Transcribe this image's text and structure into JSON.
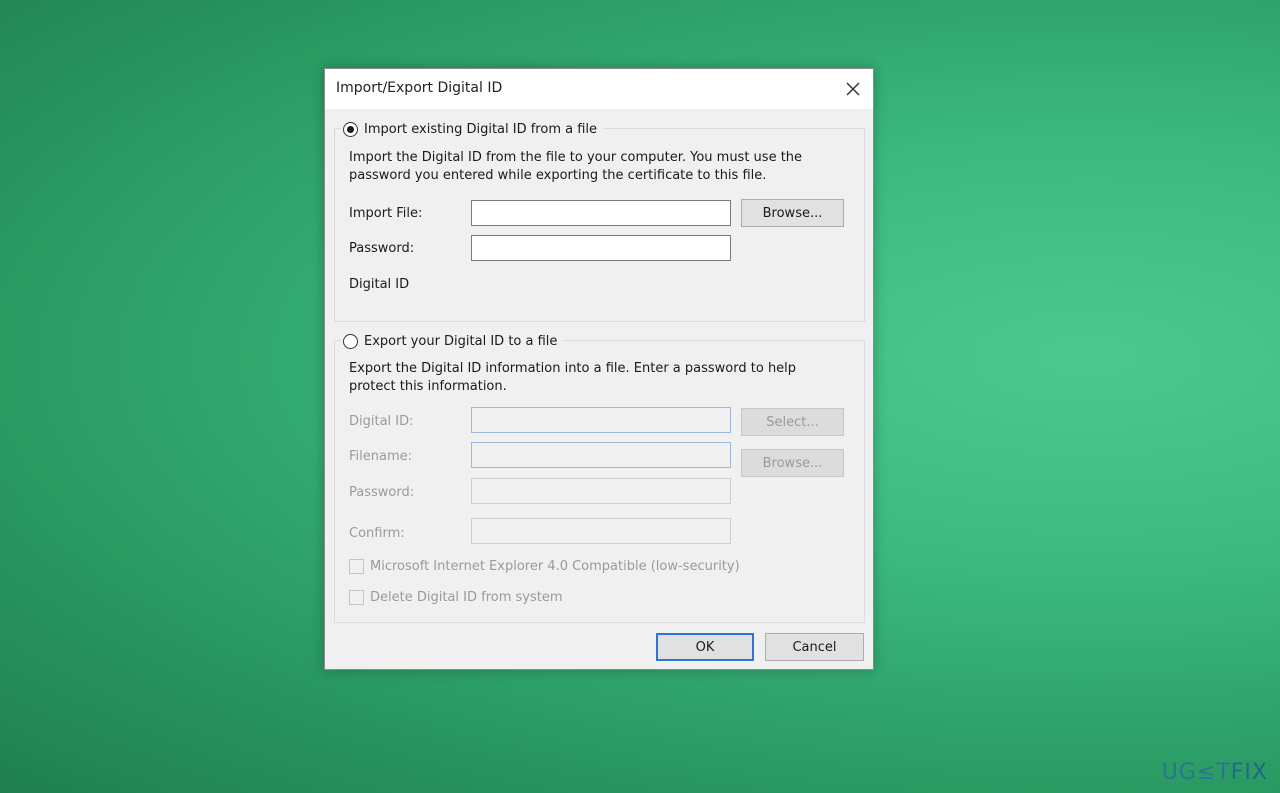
{
  "dialog": {
    "title": "Import/Export Digital ID",
    "import_section": {
      "radio_label": "Import existing Digital ID from a file",
      "selected": true,
      "description_line1": "Import the Digital ID from the file to your computer. You must use the",
      "description_line2": "password you entered while exporting the certificate to this file.",
      "import_file_label": "Import File:",
      "import_file_value": "",
      "browse_label": "Browse...",
      "password_label": "Password:",
      "password_value": "",
      "digital_id_label": "Digital ID"
    },
    "export_section": {
      "radio_label": "Export your Digital ID to a file",
      "selected": false,
      "description_line1": "Export the Digital ID information into a file. Enter a password to help",
      "description_line2": "protect this information.",
      "digital_id_label": "Digital ID:",
      "select_label": "Select...",
      "filename_label": "Filename:",
      "browse_label": "Browse...",
      "password_label": "Password:",
      "confirm_label": "Confirm:",
      "ie_compat_label": "Microsoft Internet Explorer 4.0 Compatible (low-security)",
      "delete_label": "Delete Digital ID from system"
    },
    "ok_label": "OK",
    "cancel_label": "Cancel"
  },
  "watermark": {
    "prefix": "UG",
    "mid": "≤T",
    "suffix": "FIX"
  },
  "colors": {
    "accent": "#2f74d0",
    "background_green": "#3bb97e"
  }
}
